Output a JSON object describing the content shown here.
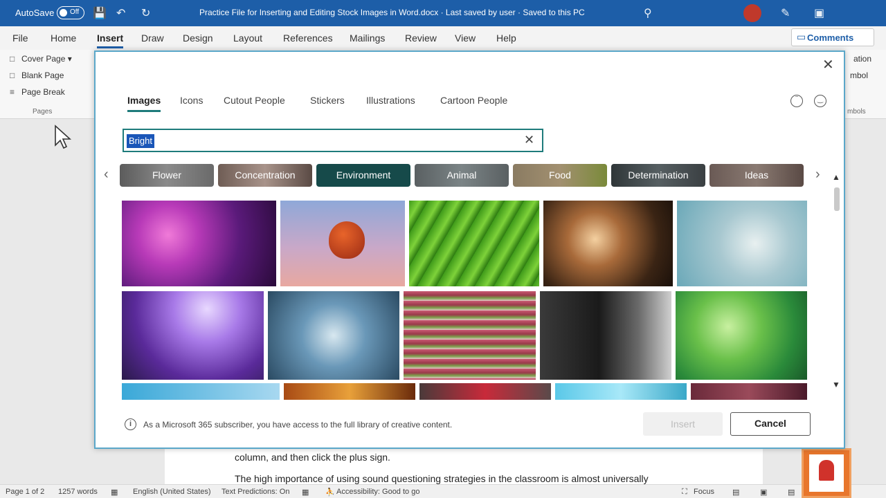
{
  "titlebar": {
    "autosave": "AutoSave",
    "toggle": "Off",
    "document": "Practice File for Inserting and Editing Stock Images in Word.docx  ·  Last saved by user  ·  Saved to this PC"
  },
  "ribbon": {
    "tabs": [
      "File",
      "Home",
      "Insert",
      "Draw",
      "Design",
      "Layout",
      "References",
      "Mailings",
      "Review",
      "View",
      "Help"
    ],
    "active_tab": "Insert",
    "comments": "Comments",
    "pages_group": {
      "items": [
        "Cover Page",
        "Blank Page",
        "Page Break"
      ],
      "label": "Pages"
    },
    "right_partial": [
      "ation",
      "mbol",
      "mbols"
    ]
  },
  "document": {
    "line1": "column, and then click the plus sign.",
    "line2": "The high importance of using sound questioning strategies in the classroom is almost universally"
  },
  "statusbar": {
    "page": "Page 1 of 2",
    "words": "1257 words",
    "language": "English (United States)",
    "predictions": "Text Predictions: On",
    "accessibility": "Accessibility: Good to go",
    "focus": "Focus"
  },
  "dialog": {
    "tabs": [
      "Images",
      "Icons",
      "Cutout People",
      "Stickers",
      "Illustrations",
      "Cartoon People"
    ],
    "active_tab": "Images",
    "search_value": "Bright",
    "chips": [
      "Flower",
      "Concentration",
      "Environment",
      "Animal",
      "Food",
      "Determination",
      "Ideas"
    ],
    "active_chip": "Environment",
    "info": "As a Microsoft 365 subscriber, you have access to the full library of creative content.",
    "insert_label": "Insert",
    "cancel_label": "Cancel"
  },
  "colors": {
    "titlebar": "#1d5ea8",
    "accent": "#1e7b7b",
    "chip_active": "#164a4a",
    "badge": "#e8762c"
  }
}
